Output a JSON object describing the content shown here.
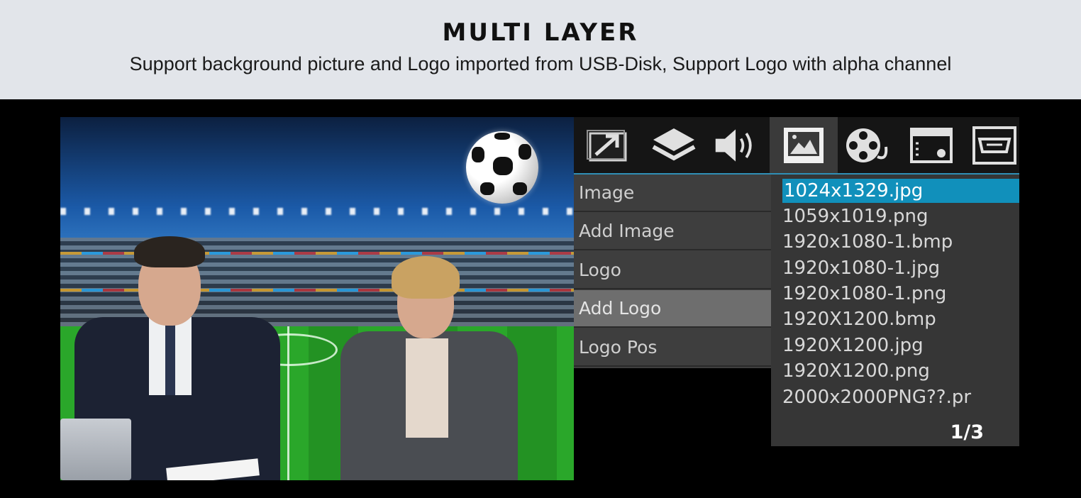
{
  "header": {
    "title": "MULTI LAYER",
    "subtitle": "Support background picture and Logo imported from USB-Disk, Support Logo with alpha channel"
  },
  "toolbar": {
    "icons": [
      "export-icon",
      "layers-icon",
      "speaker-icon",
      "image-icon",
      "film-reel-icon",
      "window-settings-icon",
      "hdmi-icon"
    ],
    "active_index": 3
  },
  "menu": {
    "items": [
      {
        "label": "Image"
      },
      {
        "label": "Add Image"
      },
      {
        "label": "Logo"
      },
      {
        "label": "Add Logo"
      },
      {
        "label": "Logo Pos"
      }
    ],
    "selected_index": 3
  },
  "files": {
    "items": [
      "1024x1329.jpg",
      "1059x1019.png",
      "1920x1080-1.bmp",
      "1920x1080-1.jpg",
      "1920x1080-1.png",
      "1920X1200.bmp",
      "1920X1200.jpg",
      "1920X1200.png",
      "2000x2000PNG??.pr"
    ],
    "selected_index": 0,
    "page": "1/3"
  },
  "colors": {
    "accent": "#1190bb",
    "header_bg": "#e2e5ea",
    "menu_bg": "#3e3e3e",
    "list_bg": "#363636"
  }
}
